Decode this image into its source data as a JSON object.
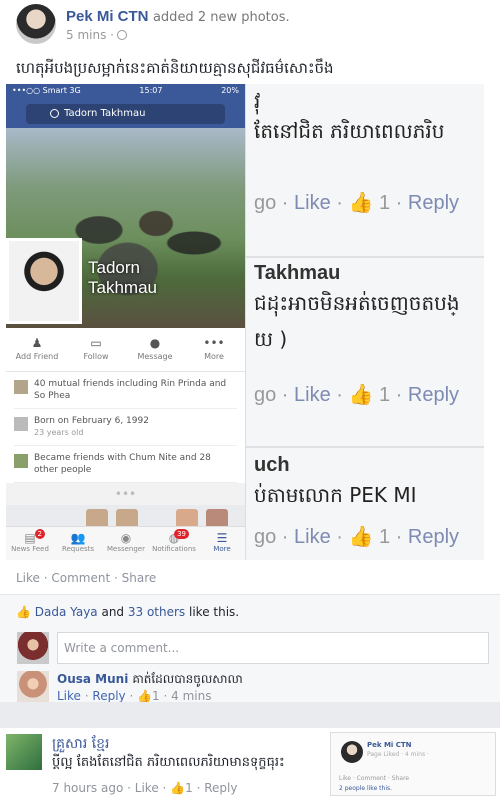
{
  "post": {
    "author": "Pek Mi CTN",
    "action": "added 2 new photos.",
    "time": "5 mins",
    "text": "ហេតុអីបងប្រសម្អាក់នេះគាត់និយាយគ្មានសុជីវធម៌សោះចឹង"
  },
  "phone": {
    "status": {
      "carrier": "•••○○ Smart 3G",
      "time": "15:07",
      "battery": "20%"
    },
    "search": "Tadorn Takhmau",
    "cover_name": "Tadorn\nTakhmau",
    "actions": [
      "Add Friend",
      "Follow",
      "Message",
      "More"
    ],
    "info": [
      {
        "text": "40 mutual friends including Rin Prinda and So Phea",
        "sub": ""
      },
      {
        "text": "Born on February 6, 1992",
        "sub": "23 years old"
      },
      {
        "text": "Became friends with Chum Nite and 28 other people",
        "sub": ""
      }
    ],
    "more": "•••",
    "tabs": [
      {
        "label": "News Feed",
        "badge": "2"
      },
      {
        "label": "Requests",
        "badge": ""
      },
      {
        "label": "Messenger",
        "badge": ""
      },
      {
        "label": "Notifications",
        "badge": "39"
      },
      {
        "label": "More",
        "badge": ""
      }
    ]
  },
  "comments_zoom": {
    "note1_line1": "វុ",
    "note1_line2": "តែនៅជិត ភរិយាពេលភរិប",
    "note1_foot": {
      "a": "go · ",
      "like": "Like",
      "b": " · ",
      "count": "1",
      "c": " · ",
      "reply": "Reply"
    },
    "note2_name": "Takhmau",
    "note2_line1": "ជដុះអាចមិនអត់ចេញចតបង្",
    "note2_line2": "យ )",
    "note2_foot": {
      "a": "go · ",
      "like": "Like",
      "b": " · ",
      "count": "1",
      "c": " · ",
      "reply": "Reply"
    },
    "note3_name": "uch",
    "note3_line1": "ប់តាមលោក PEK  MI",
    "note3_foot": {
      "a": "go · ",
      "like": "Like",
      "b": " · ",
      "count": "1",
      "c": " · ",
      "reply": "Reply"
    }
  },
  "post_actions": {
    "like": "Like",
    "comment": "Comment",
    "share": "Share"
  },
  "likes": {
    "name": "Dada Yaya",
    "and": " and ",
    "others": "33 others",
    "suffix": " like this."
  },
  "comment_input": {
    "placeholder": "Write a comment..."
  },
  "comment": {
    "author": "Ousa Muni",
    "text": "គាត់ដែលបានចូលសាលា",
    "like": "Like",
    "reply": "Reply",
    "count": "1",
    "time": "4 mins"
  },
  "post2": {
    "author": "គ្រួសារ ខ្មែរ",
    "text": "ប្ដីល្អ តែងតែនៅជិត ភរិយាពេលភរិយាមានទុក្ខធុរះ",
    "time": "7 hours ago",
    "like": "Like",
    "count": "1",
    "reply": "Reply",
    "shot_author": "Pek Mi CTN",
    "shot_sub": "Page Liked · 4 mins ·",
    "shot_actions": "Like · Comment · Share",
    "shot_likes": "2 people like this."
  }
}
